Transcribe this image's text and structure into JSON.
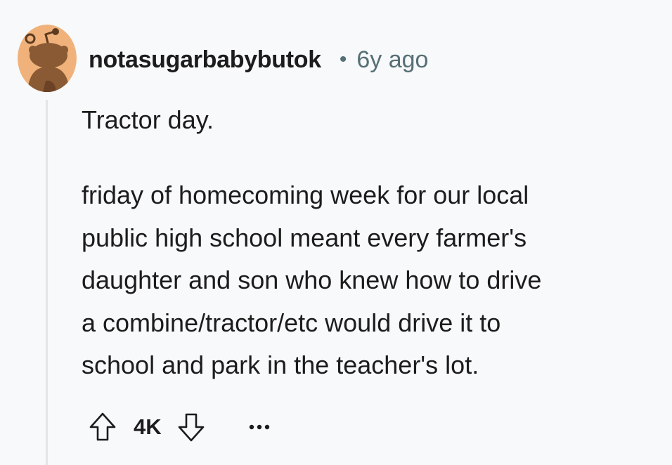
{
  "comment": {
    "username": "notasugarbabybutok",
    "separator": "•",
    "age": "6y ago",
    "title": "Tractor day.",
    "body_lines": [
      "friday of homecoming week for our local",
      "public high school meant every farmer's",
      "daughter and son who knew how to drive",
      "a combine/tractor/etc would drive it to",
      "school and park in the teacher's lot."
    ],
    "score": "4K"
  },
  "icons": {
    "avatar": "reddit-snoo-avatar",
    "upvote": "arrow-up-icon",
    "downvote": "arrow-down-icon",
    "more": "ellipsis-icon"
  },
  "colors": {
    "background": "#f7f9fa",
    "avatar_bg": "#f0b27a",
    "text_primary": "#1c1c1c",
    "text_secondary": "#576f76",
    "thread_line": "#e3e6e8"
  }
}
